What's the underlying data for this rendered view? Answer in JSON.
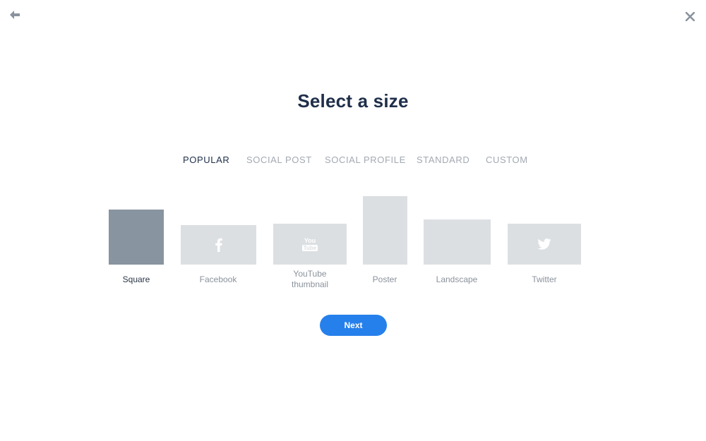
{
  "header": {
    "back_icon": "arrow-left-icon",
    "close_icon": "close-icon"
  },
  "title": "Select a size",
  "tabs": [
    {
      "label": "POPULAR",
      "active": true
    },
    {
      "label": "SOCIAL POST",
      "active": false
    },
    {
      "label": "SOCIAL PROFILE",
      "active": false
    },
    {
      "label": "STANDARD",
      "active": false
    },
    {
      "label": "CUSTOM",
      "active": false
    }
  ],
  "sizes": [
    {
      "label": "Square",
      "selected": true,
      "icon": ""
    },
    {
      "label": "Facebook",
      "selected": false,
      "icon": "facebook-icon"
    },
    {
      "label_line1": "YouTube",
      "label_line2": "thumbnail",
      "selected": false,
      "icon": "youtube-icon",
      "icon_text_top": "You",
      "icon_text_bottom": "Tube"
    },
    {
      "label": "Poster",
      "selected": false,
      "icon": ""
    },
    {
      "label": "Landscape",
      "selected": false,
      "icon": ""
    },
    {
      "label": "Twitter",
      "selected": false,
      "icon": "twitter-icon"
    }
  ],
  "next_label": "Next",
  "colors": {
    "accent": "#2680eb",
    "selected_thumb": "#8894a0",
    "thumb": "#dcdfe2",
    "title": "#1f2f4a"
  }
}
